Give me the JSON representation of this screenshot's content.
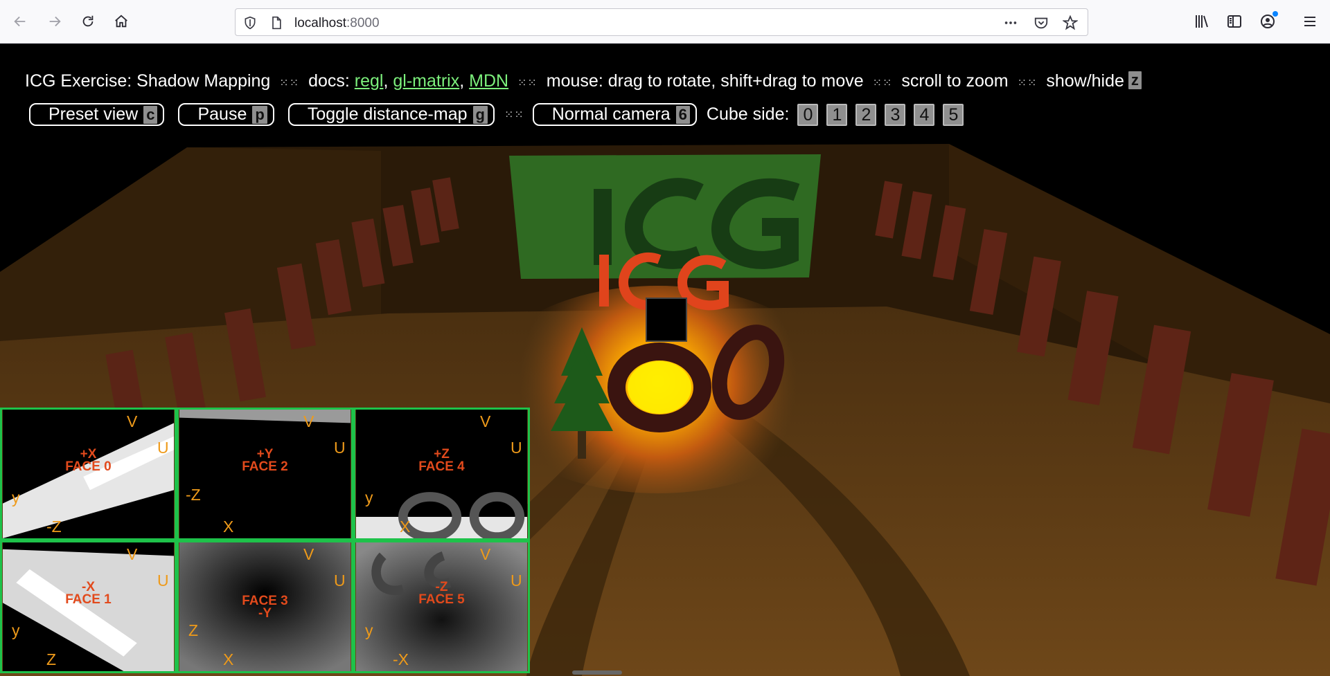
{
  "browser": {
    "url_host": "localhost",
    "url_port": ":8000",
    "icons": [
      "back-icon",
      "forward-icon",
      "reload-icon",
      "home-icon",
      "shield-icon",
      "page-icon",
      "more-icon",
      "pocket-icon",
      "star-icon",
      "library-icon",
      "sidebar-icon",
      "account-icon",
      "menu-icon"
    ]
  },
  "header": {
    "title": "ICG Exercise: Shadow Mapping",
    "docs_label": "docs:",
    "doc_links": [
      "regl",
      "gl-matrix",
      "MDN"
    ],
    "mouse_help": "mouse: drag to rotate, shift+drag to move",
    "scroll_help": "scroll to zoom",
    "showhide_label": "show/hide",
    "showhide_key": "z",
    "separator": "⁙⁙"
  },
  "controls": {
    "preset_view": {
      "label": "Preset view",
      "key": "c"
    },
    "pause": {
      "label": "Pause",
      "key": "p"
    },
    "toggle_map": {
      "label": "Toggle distance-map",
      "key": "g"
    },
    "camera": {
      "label": "Normal camera",
      "key": "6"
    },
    "cube_side_label": "Cube side:",
    "cube_sides": [
      "0",
      "1",
      "2",
      "3",
      "4",
      "5"
    ]
  },
  "scene": {
    "sign_text": "ICG",
    "sign_color": "#2f6a22",
    "letters_color": "#e0441c",
    "floor_color": "#6a4418",
    "light_color": "#ffee00"
  },
  "faces": [
    {
      "title": "+X",
      "name": "FACE 0",
      "v": "V",
      "u": "U",
      "axis_up": "y",
      "axis_right": "-Z"
    },
    {
      "title": "+Y",
      "name": "FACE 2",
      "v": "V",
      "u": "U",
      "axis_up": "-Z",
      "axis_right": "X"
    },
    {
      "title": "+Z",
      "name": "FACE 4",
      "v": "V",
      "u": "U",
      "axis_up": "y",
      "axis_right": "X"
    },
    {
      "title": "-X",
      "name": "FACE 1",
      "v": "V",
      "u": "U",
      "axis_up": "y",
      "axis_right": "Z"
    },
    {
      "title": "-Y",
      "name": "FACE 3",
      "v": "V",
      "u": "U",
      "axis_up": "Z",
      "axis_right": "X"
    },
    {
      "title": "-Z",
      "name": "FACE 5",
      "v": "V",
      "u": "U",
      "axis_up": "y",
      "axis_right": "-X"
    }
  ]
}
